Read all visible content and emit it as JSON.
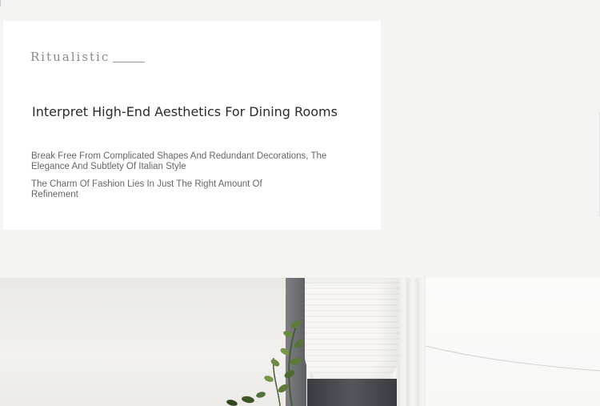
{
  "brand": {
    "wordmark": "Ritualistic"
  },
  "content": {
    "headline": "Interpret High-End Aesthetics For Dining Rooms",
    "paragraph_1": "Break Free From Complicated Shapes And Redundant Decorations, The Elegance And Subtlety Of Italian Style",
    "paragraph_2": "The Charm Of Fashion Lies In Just The Right Amount Of Refinement"
  },
  "photo": {
    "subject": "paper-lantern-floor-lamp-with-plant"
  }
}
